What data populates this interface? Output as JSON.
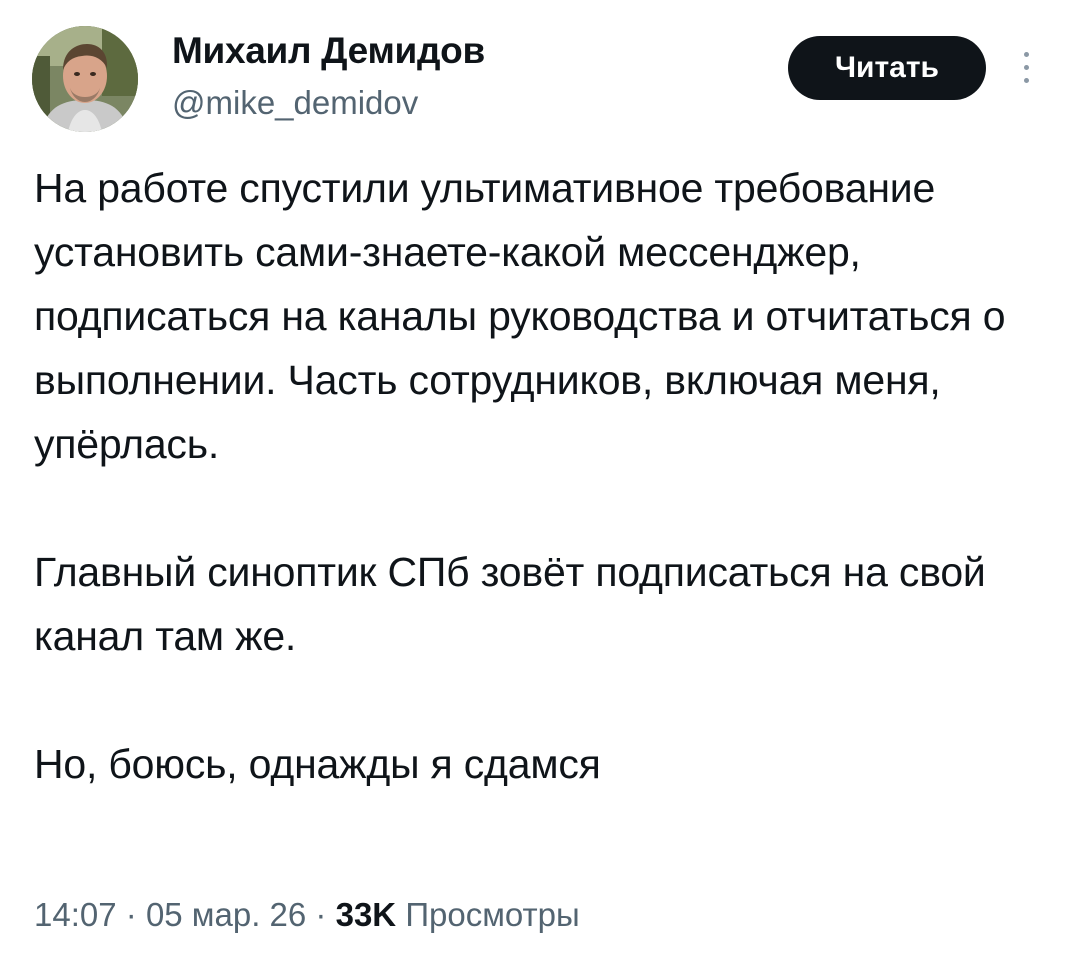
{
  "author": {
    "name": "Михаил Демидов",
    "handle": "@mike_demidov"
  },
  "actions": {
    "follow_label": "Читать",
    "more_icon": "more-vertical-icon"
  },
  "tweet": {
    "paragraphs": [
      "На работе спустили ультимативное требование установить сами-знаете-какой мессенджер, подписаться на каналы руководства и отчитаться о выполнении. Часть сотрудников, включая меня, упёрлась.",
      "Главный синоптик СПб зовёт подписаться на свой канал там же.",
      "Но, боюсь, однажды я сдамся"
    ]
  },
  "meta": {
    "time": "14:07",
    "separator": "·",
    "date": "05 мар. 26",
    "views_count": "33K",
    "views_label": "Просмотры"
  },
  "colors": {
    "text": "#0f1419",
    "secondary": "#536471",
    "button_bg": "#0f1419",
    "button_text": "#ffffff"
  }
}
